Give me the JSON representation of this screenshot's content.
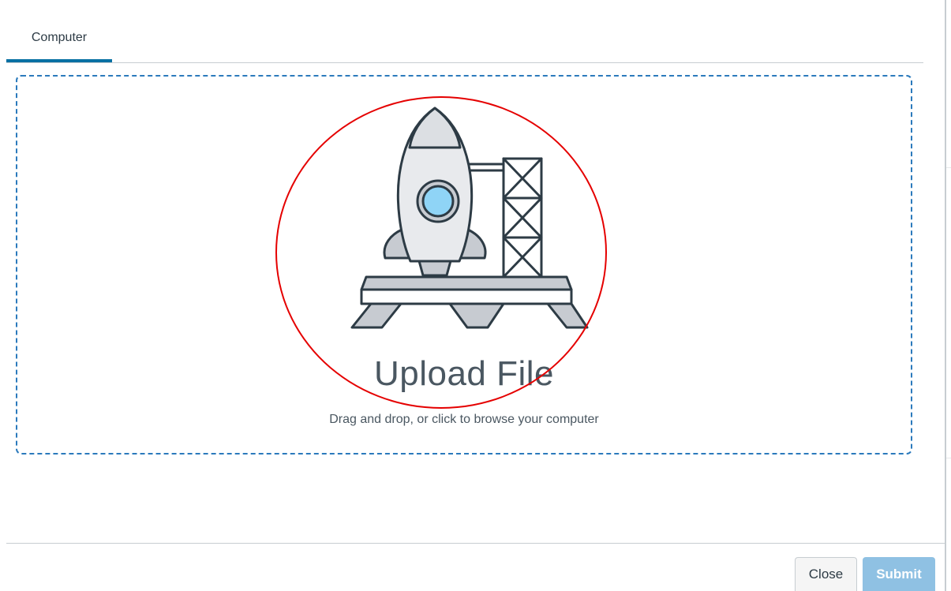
{
  "tabs": [
    {
      "label": "Computer",
      "selected": true
    }
  ],
  "dropzone": {
    "title": "Upload File",
    "subtitle": "Drag and drop, or click to browse your computer",
    "illustration": "rocket-launch-pad-icon"
  },
  "footer": {
    "close_label": "Close",
    "submit_label": "Submit"
  },
  "colors": {
    "accent": "#0770a3",
    "dropzone_border": "#2b7abc",
    "submit_bg": "#8fc1e3",
    "annotation": "#e50000"
  }
}
